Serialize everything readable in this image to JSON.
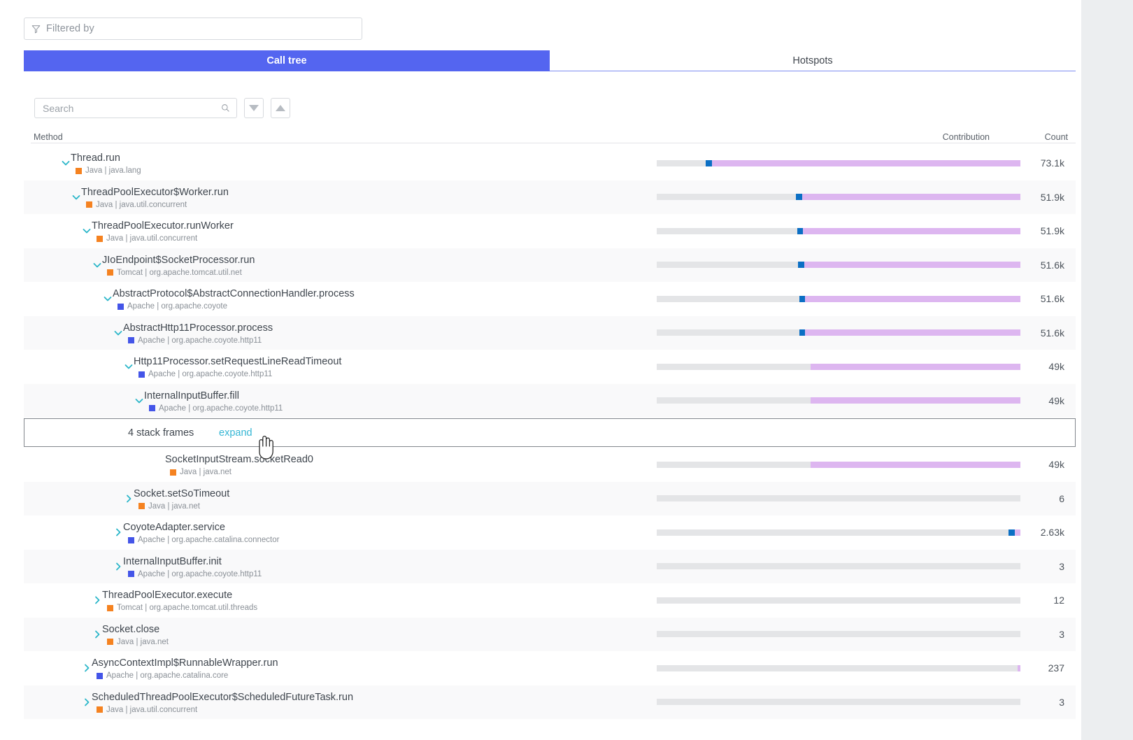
{
  "filter": {
    "placeholder": "Filtered by",
    "icon": "funnel-icon"
  },
  "tabs": [
    {
      "label": "Call tree",
      "active": true
    },
    {
      "label": "Hotspots",
      "active": false
    }
  ],
  "search": {
    "placeholder": "Search",
    "value": "",
    "icon": "search-icon",
    "next_icon": "triangle-down-icon",
    "prev_icon": "triangle-up-icon"
  },
  "columns": {
    "method": "Method",
    "contribution": "Contribution",
    "count": "Count"
  },
  "colors": {
    "accent_blue": "#5465f0",
    "tab_underline": "#7a8bf2",
    "chevron_teal": "#2bb6c9",
    "bar_gray": "#e4e5e7",
    "bar_blue": "#0b6fc4",
    "bar_purple": "#ddb6f0",
    "java_square": "#f58220",
    "tomcat_square": "#f58220",
    "apache_square": "#4455e8",
    "expand_link": "#35b6d4"
  },
  "stack_group": {
    "label": "4 stack frames",
    "expand_label": "expand"
  },
  "rows": [
    {
      "method": "Thread.run",
      "framework": "Java",
      "package": "java.lang",
      "square_color": "#f58220",
      "depth": 0,
      "expanded": true,
      "count": "73.1k",
      "bar": {
        "gray_start": 0,
        "gray_end": 13.5,
        "blue_start": 13.5,
        "blue_end": 15.2,
        "purple_start": 15.2,
        "purple_end": 100
      }
    },
    {
      "method": "ThreadPoolExecutor$Worker.run",
      "framework": "Java",
      "package": "java.util.concurrent",
      "square_color": "#f58220",
      "depth": 1,
      "expanded": true,
      "count": "51.9k",
      "bar": {
        "gray_start": 0,
        "gray_end": 38.3,
        "blue_start": 38.3,
        "blue_end": 40.0,
        "purple_start": 40.0,
        "purple_end": 100
      }
    },
    {
      "method": "ThreadPoolExecutor.runWorker",
      "framework": "Java",
      "package": "java.util.concurrent",
      "square_color": "#f58220",
      "depth": 2,
      "expanded": true,
      "count": "51.9k",
      "bar": {
        "gray_start": 0,
        "gray_end": 38.6,
        "blue_start": 38.6,
        "blue_end": 40.2,
        "purple_start": 40.2,
        "purple_end": 100
      }
    },
    {
      "method": "JIoEndpoint$SocketProcessor.run",
      "framework": "Tomcat",
      "package": "org.apache.tomcat.util.net",
      "square_color": "#f58220",
      "depth": 3,
      "expanded": true,
      "count": "51.6k",
      "bar": {
        "gray_start": 0,
        "gray_end": 38.9,
        "blue_start": 38.9,
        "blue_end": 40.5,
        "purple_start": 40.5,
        "purple_end": 100
      }
    },
    {
      "method": "AbstractProtocol$AbstractConnectionHandler.process",
      "framework": "Apache",
      "package": "org.apache.coyote",
      "square_color": "#4455e8",
      "depth": 4,
      "expanded": true,
      "count": "51.6k",
      "bar": {
        "gray_start": 0,
        "gray_end": 39.2,
        "blue_start": 39.2,
        "blue_end": 40.8,
        "purple_start": 40.8,
        "purple_end": 100
      }
    },
    {
      "method": "AbstractHttp11Processor.process",
      "framework": "Apache",
      "package": "org.apache.coyote.http11",
      "square_color": "#4455e8",
      "depth": 5,
      "expanded": true,
      "count": "51.6k",
      "bar": {
        "gray_start": 0,
        "gray_end": 39.2,
        "blue_start": 39.2,
        "blue_end": 40.8,
        "purple_start": 40.8,
        "purple_end": 100
      }
    },
    {
      "method": "Http11Processor.setRequestLineReadTimeout",
      "framework": "Apache",
      "package": "org.apache.coyote.http11",
      "square_color": "#4455e8",
      "depth": 6,
      "expanded": true,
      "count": "49k",
      "bar": {
        "gray_start": 0,
        "gray_end": 42.3,
        "blue_start": 42.3,
        "blue_end": 42.3,
        "purple_start": 42.3,
        "purple_end": 100
      }
    },
    {
      "method": "InternalInputBuffer.fill",
      "framework": "Apache",
      "package": "org.apache.coyote.http11",
      "square_color": "#4455e8",
      "depth": 7,
      "expanded": true,
      "count": "49k",
      "bar": {
        "gray_start": 0,
        "gray_end": 42.3,
        "blue_start": 42.3,
        "blue_end": 42.3,
        "purple_start": 42.3,
        "purple_end": 100
      }
    },
    {
      "method": "SocketInputStream.socketRead0",
      "framework": "Java",
      "package": "java.net",
      "square_color": "#f58220",
      "depth": 9,
      "expanded": null,
      "count": "49k",
      "bar": {
        "gray_start": 0,
        "gray_end": 42.3,
        "blue_start": 42.3,
        "blue_end": 42.3,
        "purple_start": 42.3,
        "purple_end": 100
      }
    },
    {
      "method": "Socket.setSoTimeout",
      "framework": "Java",
      "package": "java.net",
      "square_color": "#f58220",
      "depth": 6,
      "expanded": false,
      "count": "6",
      "bar": {
        "gray_start": 0,
        "gray_end": 100,
        "blue_start": 100,
        "blue_end": 100,
        "purple_start": 100,
        "purple_end": 100
      }
    },
    {
      "method": "CoyoteAdapter.service",
      "framework": "Apache",
      "package": "org.apache.catalina.connector",
      "square_color": "#4455e8",
      "depth": 5,
      "expanded": false,
      "count": "2.63k",
      "bar": {
        "gray_start": 0,
        "gray_end": 96.8,
        "blue_start": 96.8,
        "blue_end": 98.4,
        "purple_start": 98.4,
        "purple_end": 100
      }
    },
    {
      "method": "InternalInputBuffer.init",
      "framework": "Apache",
      "package": "org.apache.coyote.http11",
      "square_color": "#4455e8",
      "depth": 5,
      "expanded": false,
      "count": "3",
      "bar": {
        "gray_start": 0,
        "gray_end": 100,
        "blue_start": 100,
        "blue_end": 100,
        "purple_start": 100,
        "purple_end": 100
      }
    },
    {
      "method": "ThreadPoolExecutor.execute",
      "framework": "Tomcat",
      "package": "org.apache.tomcat.util.threads",
      "square_color": "#f58220",
      "depth": 3,
      "expanded": false,
      "count": "12",
      "bar": {
        "gray_start": 0,
        "gray_end": 100,
        "blue_start": 100,
        "blue_end": 100,
        "purple_start": 100,
        "purple_end": 100
      }
    },
    {
      "method": "Socket.close",
      "framework": "Java",
      "package": "java.net",
      "square_color": "#f58220",
      "depth": 3,
      "expanded": false,
      "count": "3",
      "bar": {
        "gray_start": 0,
        "gray_end": 100,
        "blue_start": 100,
        "blue_end": 100,
        "purple_start": 100,
        "purple_end": 100
      }
    },
    {
      "method": "AsyncContextImpl$RunnableWrapper.run",
      "framework": "Apache",
      "package": "org.apache.catalina.core",
      "square_color": "#4455e8",
      "depth": 2,
      "expanded": false,
      "count": "237",
      "bar": {
        "gray_start": 0,
        "gray_end": 99.3,
        "blue_start": 99.3,
        "blue_end": 99.3,
        "purple_start": 99.3,
        "purple_end": 100
      }
    },
    {
      "method": "ScheduledThreadPoolExecutor$ScheduledFutureTask.run",
      "framework": "Java",
      "package": "java.util.concurrent",
      "square_color": "#f58220",
      "depth": 2,
      "expanded": false,
      "count": "3",
      "bar": {
        "gray_start": 0,
        "gray_end": 100,
        "blue_start": 100,
        "blue_end": 100,
        "purple_start": 100,
        "purple_end": 100
      }
    }
  ]
}
